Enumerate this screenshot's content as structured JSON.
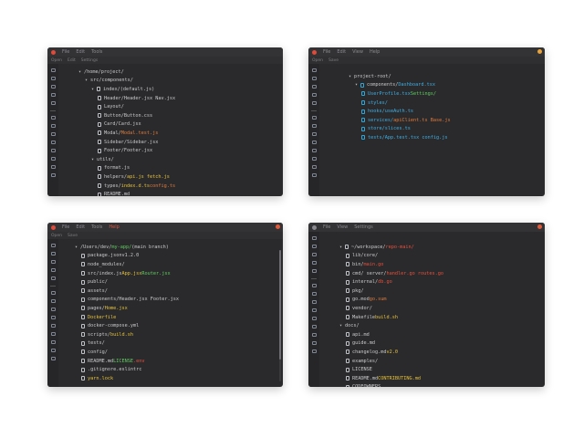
{
  "windows": [
    {
      "menu": [
        {
          "label": "File"
        },
        {
          "label": "Edit"
        },
        {
          "label": "Tools"
        }
      ],
      "toolbar": [
        {
          "label": "Open"
        },
        {
          "label": "Edit"
        },
        {
          "label": "Settings"
        }
      ],
      "rows": [
        {
          "depth": 0,
          "caret": "▾",
          "icon": false,
          "segments": [
            {
              "text": "/home/project/"
            }
          ]
        },
        {
          "depth": 1,
          "caret": "▾",
          "icon": false,
          "segments": [
            {
              "text": "src/components/"
            }
          ]
        },
        {
          "depth": 2,
          "caret": "▾",
          "icon": true,
          "segments": [
            {
              "text": "index/"
            },
            {
              "text": "  (default.js)"
            }
          ]
        },
        {
          "depth": 3,
          "caret": "",
          "icon": true,
          "segments": [
            {
              "text": "Header/"
            },
            {
              "text": "  Header.jsx  Nav.jsx"
            }
          ]
        },
        {
          "depth": 3,
          "caret": "",
          "icon": true,
          "segments": [
            {
              "text": "Layout/"
            }
          ]
        },
        {
          "depth": 3,
          "caret": "",
          "icon": true,
          "segments": [
            {
              "text": "Button/"
            },
            {
              "text": " Button.css"
            }
          ]
        },
        {
          "depth": 3,
          "caret": "",
          "icon": true,
          "segments": [
            {
              "text": "Card/"
            },
            {
              "text": " Card.jsx"
            }
          ]
        },
        {
          "depth": 3,
          "caret": "",
          "icon": true,
          "segments": [
            {
              "text": "Modal/ "
            },
            {
              "text": "Modal.test.js",
              "color": "t-orange"
            }
          ]
        },
        {
          "depth": 3,
          "caret": "",
          "icon": true,
          "segments": [
            {
              "text": "Sidebar/"
            },
            {
              "text": " Sidebar.jsx"
            }
          ]
        },
        {
          "depth": 3,
          "caret": "",
          "icon": true,
          "segments": [
            {
              "text": "Footer/"
            },
            {
              "text": " Footer.jsx"
            }
          ]
        },
        {
          "depth": 2,
          "caret": "▾",
          "icon": false,
          "segments": [
            {
              "text": "utils/"
            }
          ]
        },
        {
          "depth": 3,
          "caret": "",
          "icon": true,
          "segments": [
            {
              "text": "format.js"
            }
          ]
        },
        {
          "depth": 3,
          "caret": "",
          "icon": true,
          "segments": [
            {
              "text": "helpers/ "
            },
            {
              "text": "api.js  fetch.js",
              "color": "t-yellow"
            }
          ]
        },
        {
          "depth": 3,
          "caret": "",
          "icon": true,
          "segments": [
            {
              "text": "types/ "
            },
            {
              "text": "index.d.ts",
              "color": "t-yellow"
            },
            {
              "text": "  "
            },
            {
              "text": "config.ts",
              "color": "t-orange"
            }
          ]
        },
        {
          "depth": 3,
          "caret": "",
          "icon": true,
          "segments": [
            {
              "text": "README.md"
            }
          ]
        }
      ]
    },
    {
      "menu": [
        {
          "label": "File"
        },
        {
          "label": "Edit"
        },
        {
          "label": "View"
        },
        {
          "label": "Help"
        }
      ],
      "toolbar": [
        {
          "label": "Open"
        },
        {
          "label": "Save"
        }
      ],
      "rows": [
        {
          "depth": 0,
          "caret": "▾",
          "icon": false,
          "segments": [
            {
              "text": "project-root/"
            }
          ]
        },
        {
          "depth": 1,
          "caret": "▾",
          "icon": true,
          "segments": [
            {
              "text": "components/ "
            },
            {
              "text": "Dashboard.tsx",
              "color": "t-blue"
            }
          ]
        },
        {
          "depth": 2,
          "caret": "",
          "icon": true,
          "segments": [
            {
              "text": "UserProfile.tsx",
              "color": "t-blue"
            },
            {
              "text": "  Settings/",
              "color": "t-green"
            }
          ]
        },
        {
          "depth": 2,
          "caret": "",
          "icon": true,
          "segments": [
            {
              "text": "styles/",
              "color": "t-blue"
            }
          ]
        },
        {
          "depth": 2,
          "caret": "",
          "icon": true,
          "segments": [
            {
              "text": "hooks/",
              "color": "t-blue"
            },
            {
              "text": "  useAuth.ts",
              "color": "t-blue"
            }
          ]
        },
        {
          "depth": 2,
          "caret": "",
          "icon": true,
          "segments": [
            {
              "text": "services/",
              "color": "t-blue"
            },
            {
              "text": " apiClient.ts  Base.js",
              "color": "t-orange"
            }
          ]
        },
        {
          "depth": 2,
          "caret": "",
          "icon": true,
          "segments": [
            {
              "text": "store/",
              "color": "t-blue"
            },
            {
              "text": "  slices.ts",
              "color": "t-blue"
            }
          ]
        },
        {
          "depth": 2,
          "caret": "",
          "icon": true,
          "segments": [
            {
              "text": "tests/",
              "color": "t-blue"
            },
            {
              "text": "  App.test.tsx  config.js",
              "color": "t-blue"
            }
          ]
        }
      ]
    },
    {
      "menu": [
        {
          "label": "File"
        },
        {
          "label": "Edit"
        },
        {
          "label": "Tools"
        },
        {
          "label": "Help",
          "hot": true
        }
      ],
      "toolbar": [
        {
          "label": "Open"
        },
        {
          "label": "Save"
        }
      ],
      "rows": [
        {
          "depth": 0,
          "caret": "▾",
          "icon": false,
          "segments": [
            {
              "text": "/Users/dev/ "
            },
            {
              "text": "my-app/",
              "color": "t-green"
            },
            {
              "text": "  (main branch)"
            }
          ]
        },
        {
          "depth": 1,
          "caret": "",
          "icon": true,
          "segments": [
            {
              "text": "package.json"
            },
            {
              "text": "  v1.2.0"
            }
          ]
        },
        {
          "depth": 1,
          "caret": "",
          "icon": true,
          "segments": [
            {
              "text": "node_modules/"
            }
          ]
        },
        {
          "depth": 1,
          "caret": "",
          "icon": true,
          "segments": [
            {
              "text": "src/index.js"
            },
            {
              "text": "  App.jsx",
              "color": "t-yellow"
            },
            {
              "text": "  Router.jsx",
              "color": "t-green"
            }
          ]
        },
        {
          "depth": 1,
          "caret": "",
          "icon": true,
          "segments": [
            {
              "text": "public/"
            }
          ]
        },
        {
          "depth": 1,
          "caret": "",
          "icon": true,
          "segments": [
            {
              "text": "assets/"
            }
          ]
        },
        {
          "depth": 1,
          "caret": "",
          "icon": true,
          "segments": [
            {
              "text": "components/"
            },
            {
              "text": "  Header.jsx  Footer.jsx"
            }
          ]
        },
        {
          "depth": 1,
          "caret": "",
          "icon": true,
          "segments": [
            {
              "text": "pages/ "
            },
            {
              "text": "Home.jsx",
              "color": "t-yellow"
            }
          ]
        },
        {
          "depth": 1,
          "caret": "",
          "icon": true,
          "segments": [
            {
              "text": "Dockerfile",
              "color": "t-yellow"
            }
          ]
        },
        {
          "depth": 1,
          "caret": "",
          "icon": true,
          "segments": [
            {
              "text": "docker-compose.yml"
            }
          ]
        },
        {
          "depth": 1,
          "caret": "",
          "icon": true,
          "segments": [
            {
              "text": "scripts/"
            },
            {
              "text": "  build.sh",
              "color": "t-yellow"
            }
          ]
        },
        {
          "depth": 1,
          "caret": "",
          "icon": true,
          "segments": [
            {
              "text": "tests/"
            }
          ]
        },
        {
          "depth": 1,
          "caret": "",
          "icon": true,
          "segments": [
            {
              "text": "config/"
            }
          ]
        },
        {
          "depth": 1,
          "caret": "",
          "icon": true,
          "segments": [
            {
              "text": "README.md"
            },
            {
              "text": "  LICENSE",
              "color": "t-green"
            },
            {
              "text": "  .env",
              "color": "t-red"
            }
          ]
        },
        {
          "depth": 1,
          "caret": "",
          "icon": true,
          "segments": [
            {
              "text": ".gitignore"
            },
            {
              "text": "  .eslintrc"
            }
          ]
        },
        {
          "depth": 1,
          "caret": "",
          "icon": true,
          "segments": [
            {
              "text": "yarn.lock",
              "color": "t-yellow"
            }
          ]
        }
      ]
    },
    {
      "menu": [
        {
          "label": "File"
        },
        {
          "label": "View"
        },
        {
          "label": "Settings"
        }
      ],
      "toolbar": [],
      "rows": [
        {
          "depth": 0,
          "caret": "▾",
          "icon": true,
          "segments": [
            {
              "text": "~/workspace/"
            },
            {
              "text": "  repo-main/",
              "color": "t-red"
            }
          ]
        },
        {
          "depth": 1,
          "caret": "",
          "icon": true,
          "segments": [
            {
              "text": "lib/"
            },
            {
              "text": " core/"
            }
          ]
        },
        {
          "depth": 1,
          "caret": "",
          "icon": true,
          "segments": [
            {
              "text": "bin/ "
            },
            {
              "text": "main.go",
              "color": "t-red"
            }
          ]
        },
        {
          "depth": 1,
          "caret": "",
          "icon": true,
          "segments": [
            {
              "text": "cmd/ server/ "
            },
            {
              "text": "handler.go  routes.go",
              "color": "t-red"
            }
          ]
        },
        {
          "depth": 1,
          "caret": "",
          "icon": true,
          "segments": [
            {
              "text": "internal/ "
            },
            {
              "text": "db.go",
              "color": "t-red"
            }
          ]
        },
        {
          "depth": 1,
          "caret": "",
          "icon": true,
          "segments": [
            {
              "text": "pkg/"
            }
          ]
        },
        {
          "depth": 1,
          "caret": "",
          "icon": true,
          "segments": [
            {
              "text": "go.mod"
            },
            {
              "text": " go.sum",
              "color": "t-orange"
            }
          ]
        },
        {
          "depth": 1,
          "caret": "",
          "icon": true,
          "segments": [
            {
              "text": "vendor/"
            }
          ]
        },
        {
          "depth": 1,
          "caret": "",
          "icon": true,
          "segments": [
            {
              "text": "Makefile"
            },
            {
              "text": "  build.sh",
              "color": "t-yellow"
            }
          ]
        },
        {
          "depth": 0,
          "caret": "▾",
          "icon": false,
          "segments": [
            {
              "text": "docs/"
            }
          ]
        },
        {
          "depth": 1,
          "caret": "",
          "icon": true,
          "segments": [
            {
              "text": "api.md"
            }
          ]
        },
        {
          "depth": 1,
          "caret": "",
          "icon": true,
          "segments": [
            {
              "text": "guide.md"
            }
          ]
        },
        {
          "depth": 1,
          "caret": "",
          "icon": true,
          "segments": [
            {
              "text": "changelog.md"
            },
            {
              "text": "  v2.0",
              "color": "t-yellow"
            }
          ]
        },
        {
          "depth": 1,
          "caret": "",
          "icon": true,
          "segments": [
            {
              "text": "examples/"
            }
          ]
        },
        {
          "depth": 1,
          "caret": "",
          "icon": true,
          "segments": [
            {
              "text": "LICENSE"
            }
          ]
        },
        {
          "depth": 1,
          "caret": "",
          "icon": true,
          "segments": [
            {
              "text": "README.md"
            },
            {
              "text": "  CONTRIBUTING.md",
              "color": "t-yellow"
            }
          ]
        },
        {
          "depth": 1,
          "caret": "",
          "icon": true,
          "segments": [
            {
              "text": "CODEOWNERS"
            }
          ]
        }
      ]
    }
  ]
}
